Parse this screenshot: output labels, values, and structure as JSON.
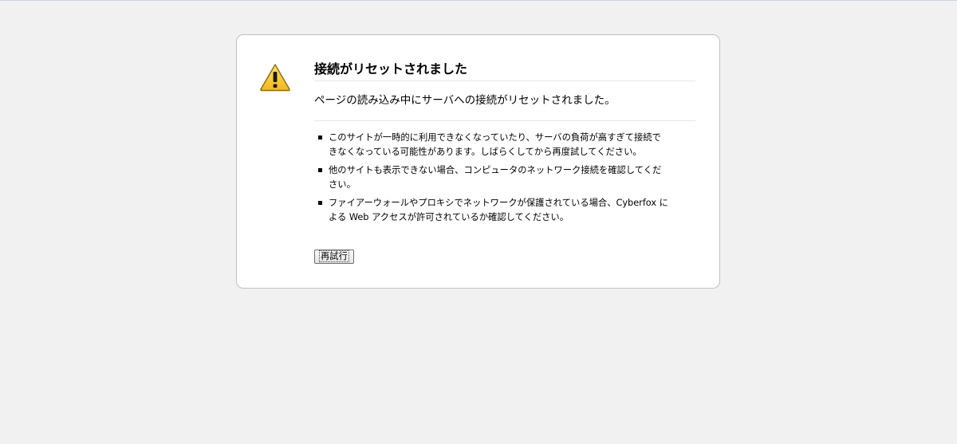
{
  "error_page": {
    "title": "接続がリセットされました",
    "short_description": "ページの読み込み中にサーバへの接続がリセットされました。",
    "long_description": [
      "このサイトが一時的に利用できなくなっていたり、サーバの負荷が高すぎて接続できなくなっている可能性があります。しばらくしてから再度試してください。",
      "他のサイトも表示できない場合、コンピュータのネットワーク接続を確認してください。",
      "ファイアーウォールやプロキシでネットワークが保護されている場合、Cyberfox による Web アクセスが許可されているか確認してください。"
    ],
    "try_again_label": "再試行",
    "icon": "warning-icon"
  }
}
